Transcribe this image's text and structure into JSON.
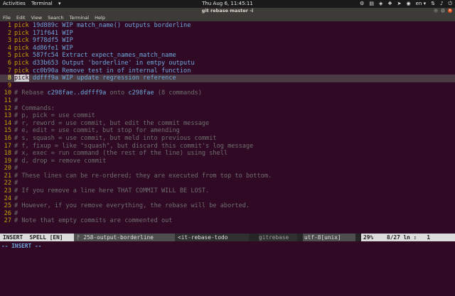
{
  "topbar": {
    "activities": "Activities",
    "app_name": "Terminal",
    "app_arrow": "▾",
    "clock": "Thu Aug 6, 11:45:11",
    "language": "en",
    "tray_icons": [
      "settings-icon",
      "notes-icon",
      "shield-icon",
      "dropbox-icon",
      "telegram-icon",
      "chrome-icon",
      "keyboard-icon",
      "network-icon",
      "volume-icon",
      "power-icon"
    ]
  },
  "window": {
    "title": "git rebase master -i"
  },
  "menu": [
    "File",
    "Edit",
    "View",
    "Search",
    "Terminal",
    "Help"
  ],
  "editor": {
    "todo": [
      {
        "n": "1",
        "cmd": "pick",
        "hash": "19d889c",
        "msg": "WIP match_name() outputs borderline"
      },
      {
        "n": "2",
        "cmd": "pick",
        "hash": "171f641",
        "msg": "WIP"
      },
      {
        "n": "3",
        "cmd": "pick",
        "hash": "9f78df5",
        "msg": "WIP"
      },
      {
        "n": "4",
        "cmd": "pick",
        "hash": "4d86fe1",
        "msg": "WIP"
      },
      {
        "n": "5",
        "cmd": "pick",
        "hash": "587fc54",
        "msg": "Extract expect_names_match_name"
      },
      {
        "n": "6",
        "cmd": "pick",
        "hash": "d33b653",
        "msg": "Output 'borderline' in emtpy outputu"
      },
      {
        "n": "7",
        "cmd": "pick",
        "hash": "cc0b90a",
        "msg": "Remove test in of internal function"
      },
      {
        "n": "8",
        "cmd": "pick",
        "hash": "ddfff9a",
        "msg": "WIP update regression reference"
      }
    ],
    "line9": "9",
    "rebase_line": {
      "n": "10",
      "prefix": "# Rebase ",
      "range": "c298fae..ddfff9a",
      "onto": " onto ",
      "target": "c298fae",
      "suffix": " (8 commands)"
    },
    "comments": [
      {
        "n": "11",
        "text": "#"
      },
      {
        "n": "12",
        "text": "# Commands:"
      },
      {
        "n": "13",
        "text": "# p, pick = use commit"
      },
      {
        "n": "14",
        "text": "# r, reword = use commit, but edit the commit message"
      },
      {
        "n": "15",
        "text": "# e, edit = use commit, but stop for amending"
      },
      {
        "n": "16",
        "text": "# s, squash = use commit, but meld into previous commit"
      },
      {
        "n": "17",
        "text": "# f, fixup = like \"squash\", but discard this commit's log message"
      },
      {
        "n": "18",
        "text": "# x, exec = run command (the rest of the line) using shell"
      },
      {
        "n": "19",
        "text": "# d, drop = remove commit"
      },
      {
        "n": "20",
        "text": "#"
      },
      {
        "n": "21",
        "text": "# These lines can be re-ordered; they are executed from top to bottom."
      },
      {
        "n": "22",
        "text": "#"
      },
      {
        "n": "23",
        "text": "# If you remove a line here THAT COMMIT WILL BE LOST."
      },
      {
        "n": "24",
        "text": "#"
      },
      {
        "n": "25",
        "text": "# However, if you remove everything, the rebase will be aborted."
      },
      {
        "n": "26",
        "text": "#"
      },
      {
        "n": "27",
        "text": "# Note that empty commits are commented out"
      }
    ]
  },
  "statusline": {
    "mode": "INSERT  SPELL [EN]",
    "branch": "ᚠ 258-output-borderline",
    "file": "<it-rebase-todo",
    "filetype": "gitrebase",
    "encoding": "utf-8[unix]",
    "percent": "29%",
    "position": "8/27 ln :   1"
  },
  "cmdline": "-- INSERT --"
}
